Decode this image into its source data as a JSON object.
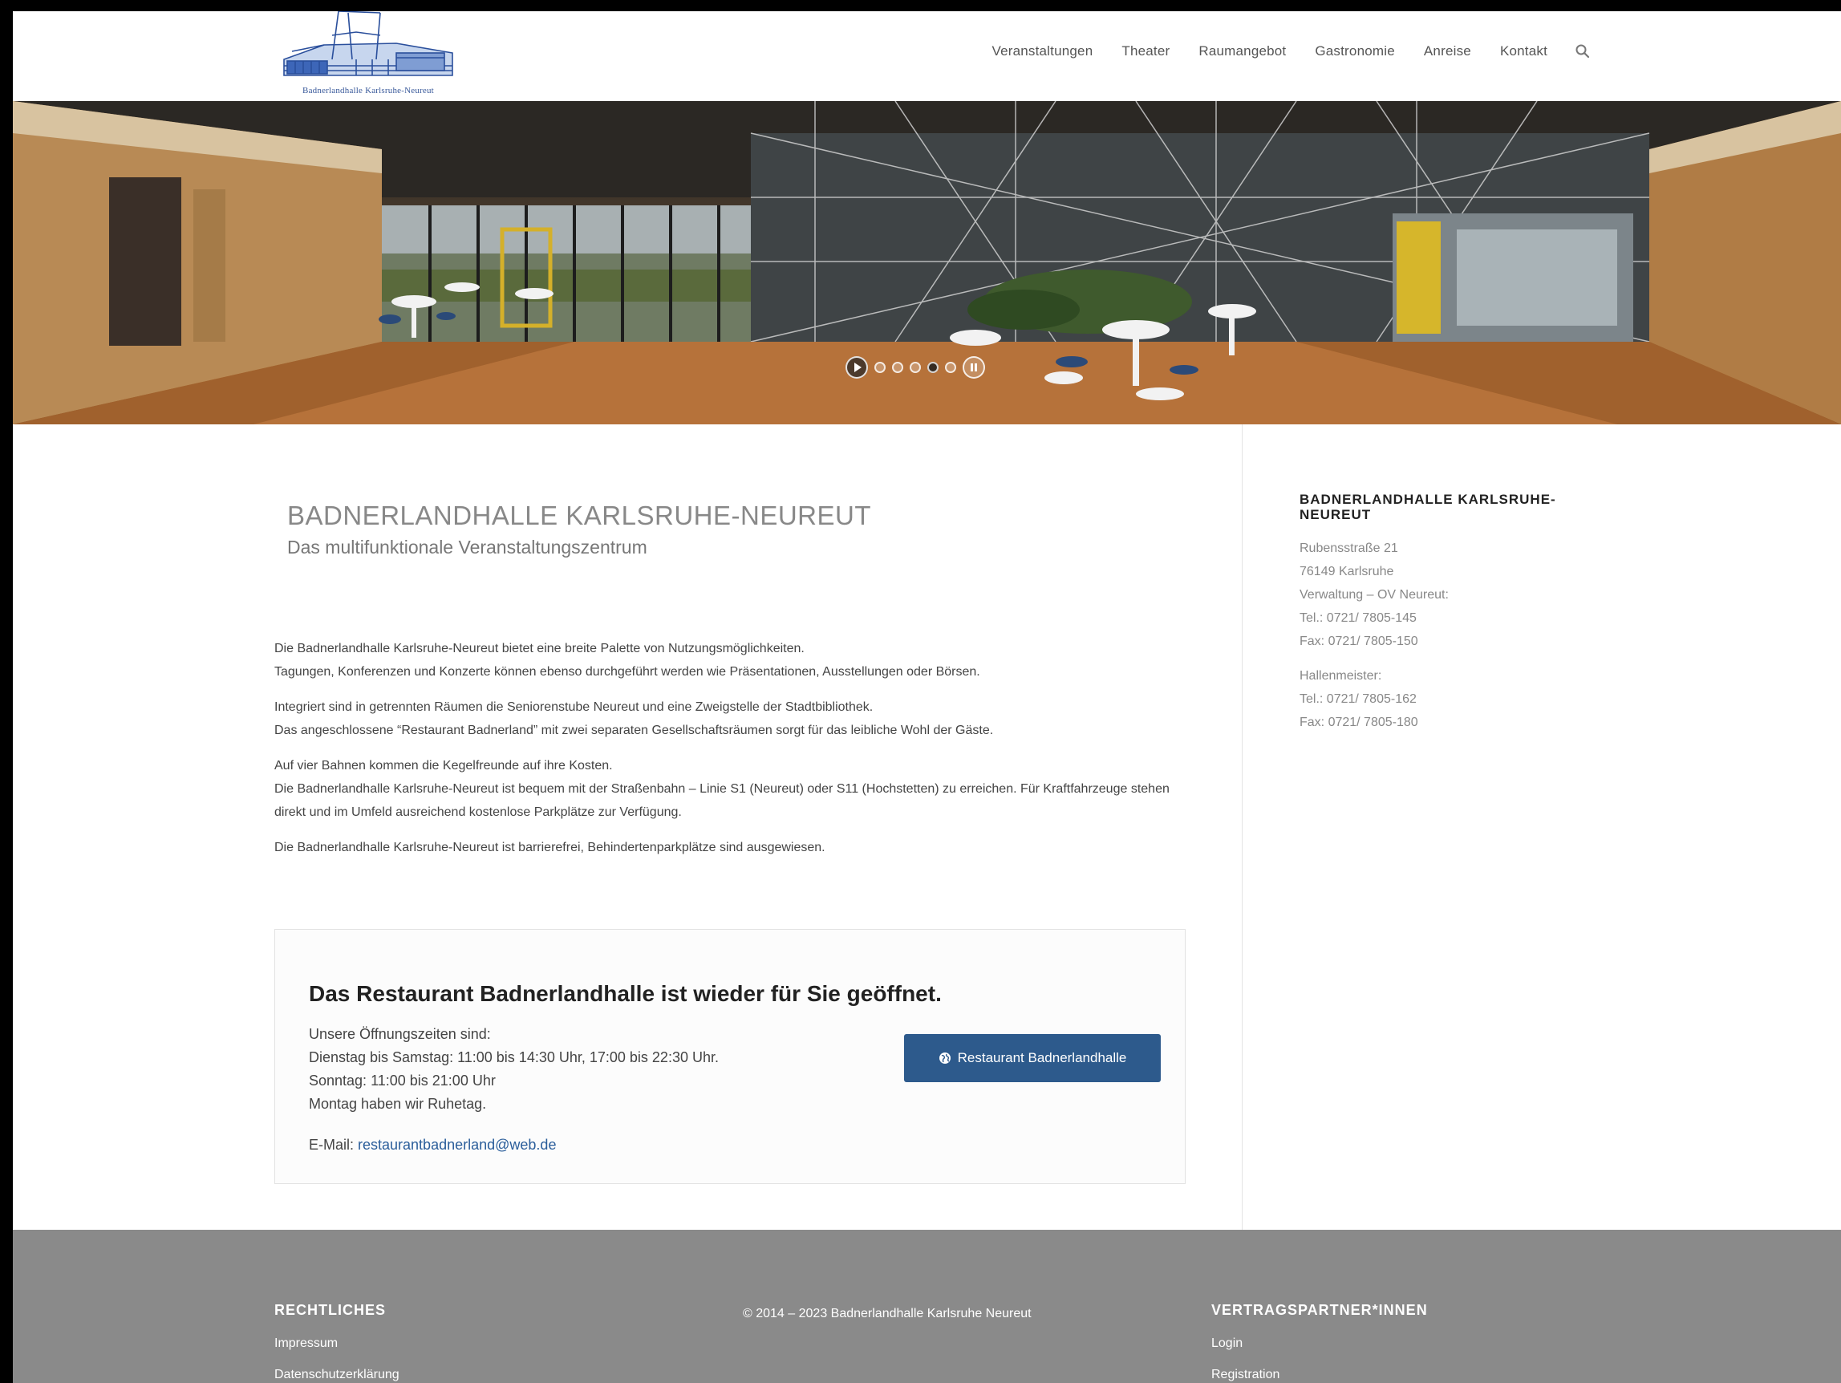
{
  "header": {
    "logo_text": "Badnerlandhalle Karlsruhe-Neureut",
    "nav": [
      "Veranstaltungen",
      "Theater",
      "Raumangebot",
      "Gastronomie",
      "Anreise",
      "Kontakt"
    ]
  },
  "slider": {
    "dots": 5,
    "active_index": 3
  },
  "main": {
    "title": "BADNERLANDHALLE KARLSRUHE-NEUREUT",
    "subtitle": "Das multifunktionale Veranstaltungszentrum",
    "paragraphs": [
      [
        "Die Badnerlandhalle Karlsruhe-Neureut bietet eine breite Palette von Nutzungsmöglichkeiten.",
        "Tagungen, Konferenzen und Konzerte können ebenso durchgeführt werden wie Präsentationen, Ausstellungen oder Börsen."
      ],
      [
        "Integriert sind in getrennten Räumen die Seniorenstube Neureut und eine Zweigstelle der Stadtbibliothek.",
        "Das angeschlossene “Restaurant Badnerland” mit zwei  separaten Gesellschaftsräumen sorgt für das leibliche Wohl der Gäste."
      ],
      [
        "Auf vier Bahnen kommen die Kegelfreunde auf ihre Kosten.",
        "Die Badnerlandhalle Karlsruhe-Neureut ist bequem mit der Straßenbahn – Linie S1 (Neureut) oder S11 (Hochstetten) zu erreichen. Für Kraftfahrzeuge stehen direkt und im Umfeld ausreichend kostenlose Parkplätze zur Verfügung."
      ],
      [
        "Die Badnerlandhalle Karlsruhe-Neureut ist barrierefrei, Behindertenparkplätze sind ausgewiesen."
      ]
    ]
  },
  "restaurant_box": {
    "title": "Das Restaurant Badnerlandhalle ist wieder für Sie geöffnet.",
    "lines": [
      "Unsere Öffnungszeiten sind:",
      "Dienstag bis Samstag: 11:00 bis 14:30 Uhr, 17:00 bis 22:30 Uhr.",
      "Sonntag: 11:00 bis 21:00 Uhr",
      "Montag haben wir Ruhetag."
    ],
    "email_label": "E-Mail: ",
    "email": "restaurantbadnerland@web.de",
    "button_label": "Restaurant Badnerlandhalle"
  },
  "sidebar": {
    "title": "BADNERLANDHALLE KARLSRUHE-NEUREUT",
    "block1": [
      "Rubensstraße 21",
      "76149 Karlsruhe",
      "Verwaltung – OV Neureut:",
      "Tel.: 0721/ 7805-145",
      "Fax: 0721/ 7805-150"
    ],
    "block2": [
      "Hallenmeister:",
      "Tel.: 0721/ 7805-162",
      "Fax: 0721/ 7805-180"
    ]
  },
  "footer": {
    "left_heading": "RECHTLICHES",
    "left_links": [
      "Impressum",
      "Datenschutzerklärung"
    ],
    "copyright": "© 2014 – 2023 Badnerlandhalle Karlsruhe Neureut",
    "right_heading": "VERTRAGSPARTNER*INNEN",
    "right_links": [
      "Login",
      "Registration"
    ]
  },
  "colors": {
    "button": "#2d5a8c",
    "footer": "#8a8a8a",
    "link": "#2a5d9a"
  }
}
